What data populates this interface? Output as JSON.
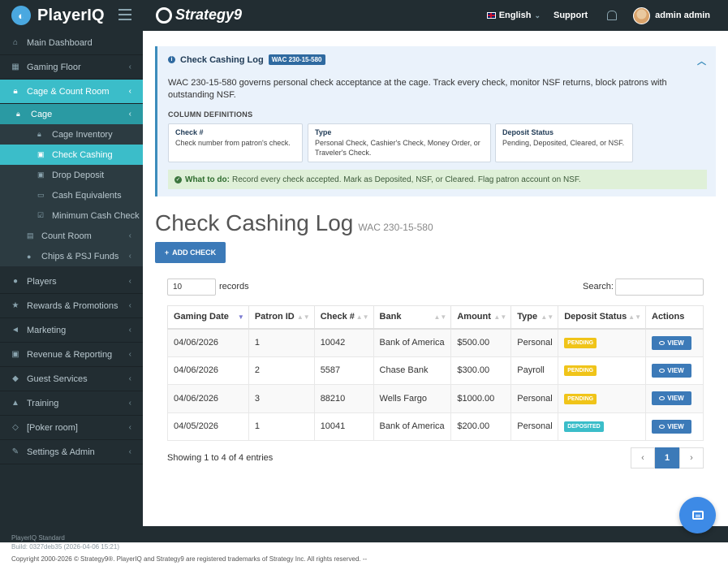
{
  "topbar": {
    "brand": "PlayerIQ",
    "partner": "Strategy9",
    "language": "English",
    "support": "Support",
    "user": "admin admin"
  },
  "sidebar": {
    "items": [
      {
        "label": "Main Dashboard",
        "icon": "home-icon"
      },
      {
        "label": "Gaming Floor",
        "icon": "table-icon"
      },
      {
        "label": "Cage & Count Room",
        "icon": "lock-icon",
        "active": true
      },
      {
        "label": "Players",
        "icon": "user-icon"
      },
      {
        "label": "Rewards & Promotions",
        "icon": "star-icon"
      },
      {
        "label": "Marketing",
        "icon": "bullhorn-icon"
      },
      {
        "label": "Revenue & Reporting",
        "icon": "money-icon"
      },
      {
        "label": "Guest Services",
        "icon": "users-icon"
      },
      {
        "label": "Training",
        "icon": "graduation-cap-icon"
      },
      {
        "label": "[Poker room]",
        "icon": "diamond-icon"
      },
      {
        "label": "Settings & Admin",
        "icon": "wrench-icon"
      }
    ],
    "cage_label": "Cage",
    "cage_items": [
      {
        "label": "Cage Inventory"
      },
      {
        "label": "Check Cashing",
        "selected": true
      },
      {
        "label": "Drop Deposit"
      },
      {
        "label": "Cash Equivalents"
      },
      {
        "label": "Minimum Cash Check"
      }
    ],
    "count_room": "Count Room",
    "chips": "Chips & PSJ Funds"
  },
  "footer": {
    "edition": "PlayerIQ Standard",
    "build": "Build: 0327deb35 (2026-04-06 15:21)",
    "copyright": "Copyright 2000-2026 © Strategy9®. PlayerIQ and Strategy9 are registered trademarks of Strategy Inc. All rights reserved. --"
  },
  "info": {
    "title": "Check Cashing Log",
    "badge": "WAC 230-15-580",
    "description": "WAC 230-15-580 governs personal check acceptance at the cage. Track every check, monitor NSF returns, block patrons with outstanding NSF.",
    "column_defs_title": "COLUMN DEFINITIONS",
    "defs": [
      {
        "term": "Check #",
        "desc": "Check number from patron's check."
      },
      {
        "term": "Type",
        "desc": "Personal Check, Cashier's Check, Money Order, or Traveler's Check."
      },
      {
        "term": "Deposit Status",
        "desc": "Pending, Deposited, Cleared, or NSF."
      }
    ],
    "what_to_do_label": "What to do:",
    "what_to_do": "Record every check accepted. Mark as Deposited, NSF, or Cleared. Flag patron account on NSF."
  },
  "page": {
    "title": "Check Cashing Log",
    "subtitle": "WAC 230-15-580",
    "add_button": "ADD CHECK",
    "page_length": "10",
    "records_label": "records",
    "search_label": "Search:",
    "showing": "Showing 1 to 4 of 4 entries",
    "pager": {
      "prev": "‹",
      "current": "1",
      "next": "›"
    }
  },
  "table": {
    "headers": [
      "Gaming Date",
      "Patron ID",
      "Check #",
      "Bank",
      "Amount",
      "Type",
      "Deposit Status",
      "Actions"
    ],
    "view_label": "VIEW",
    "rows": [
      {
        "date": "04/06/2026",
        "patron": "1",
        "check": "10042",
        "bank": "Bank of America",
        "amount": "$500.00",
        "type": "Personal",
        "status": "PENDING"
      },
      {
        "date": "04/06/2026",
        "patron": "2",
        "check": "5587",
        "bank": "Chase Bank",
        "amount": "$300.00",
        "type": "Payroll",
        "status": "PENDING"
      },
      {
        "date": "04/06/2026",
        "patron": "3",
        "check": "88210",
        "bank": "Wells Fargo",
        "amount": "$1000.00",
        "type": "Personal",
        "status": "PENDING"
      },
      {
        "date": "04/05/2026",
        "patron": "1",
        "check": "10041",
        "bank": "Bank of America",
        "amount": "$200.00",
        "type": "Personal",
        "status": "DEPOSITED"
      }
    ]
  },
  "colors": {
    "accent": "#3bbdc9",
    "primary_button": "#3c7ab8",
    "pending": "#f0c419",
    "deposited": "#3bbdc9"
  }
}
